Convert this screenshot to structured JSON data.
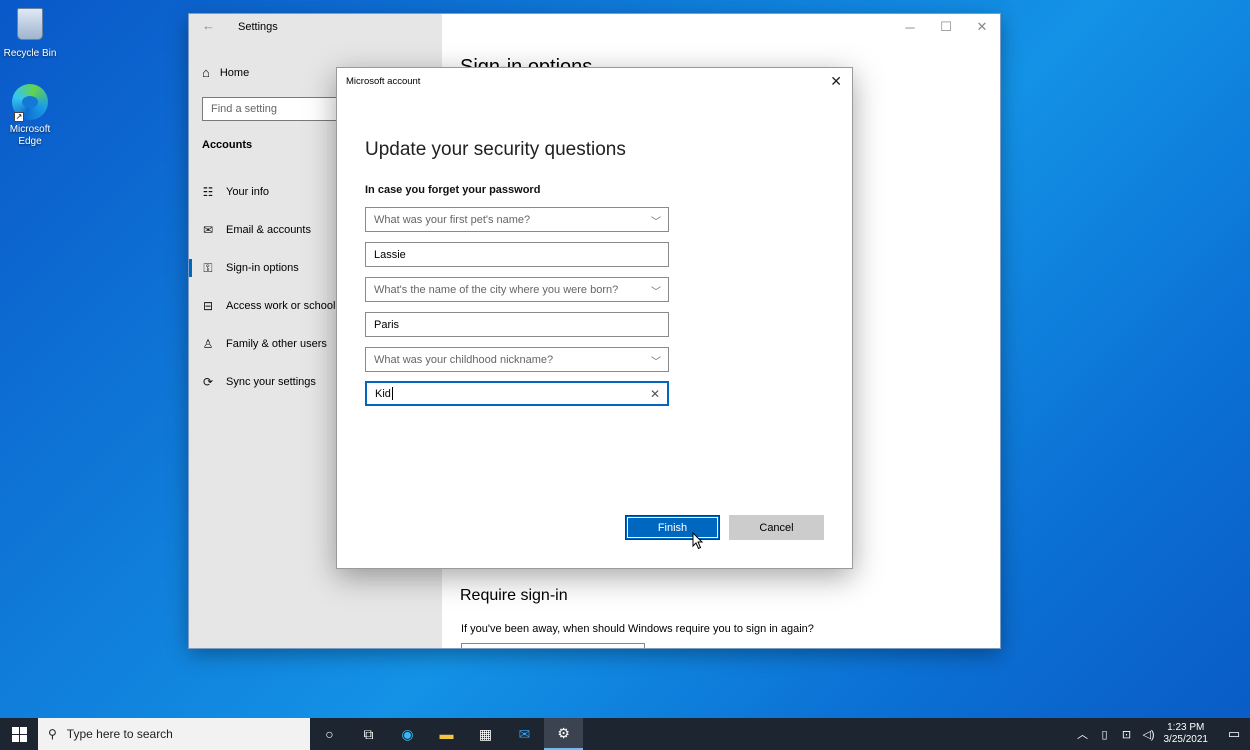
{
  "desktop": {
    "icons": [
      {
        "label": "Recycle Bin"
      },
      {
        "label": "Microsoft Edge"
      }
    ]
  },
  "settings": {
    "title": "Settings",
    "home": "Home",
    "search_placeholder": "Find a setting",
    "section": "Accounts",
    "nav": [
      {
        "label": "Your info",
        "icon": "person-card-icon"
      },
      {
        "label": "Email & accounts",
        "icon": "mail-icon"
      },
      {
        "label": "Sign-in options",
        "icon": "key-icon",
        "active": true
      },
      {
        "label": "Access work or school",
        "icon": "briefcase-icon"
      },
      {
        "label": "Family & other users",
        "icon": "person-add-icon"
      },
      {
        "label": "Sync your settings",
        "icon": "sync-icon"
      }
    ],
    "content_title_peek": "Sign-in options",
    "require_heading": "Require sign-in",
    "require_text": "If you've been away, when should Windows require you to sign in again?"
  },
  "dialog": {
    "title": "Microsoft account",
    "heading": "Update your security questions",
    "subheading": "In case you forget your password",
    "q1": "What was your first pet's name?",
    "a1": "Lassie",
    "q2": "What's the name of the city where you were born?",
    "a2": "Paris",
    "q3": "What was your childhood nickname?",
    "a3": "Kid",
    "finish": "Finish",
    "cancel": "Cancel"
  },
  "taskbar": {
    "search_placeholder": "Type here to search",
    "time": "1:23 PM",
    "date": "3/25/2021",
    "accent_color": "#76b9ed"
  }
}
